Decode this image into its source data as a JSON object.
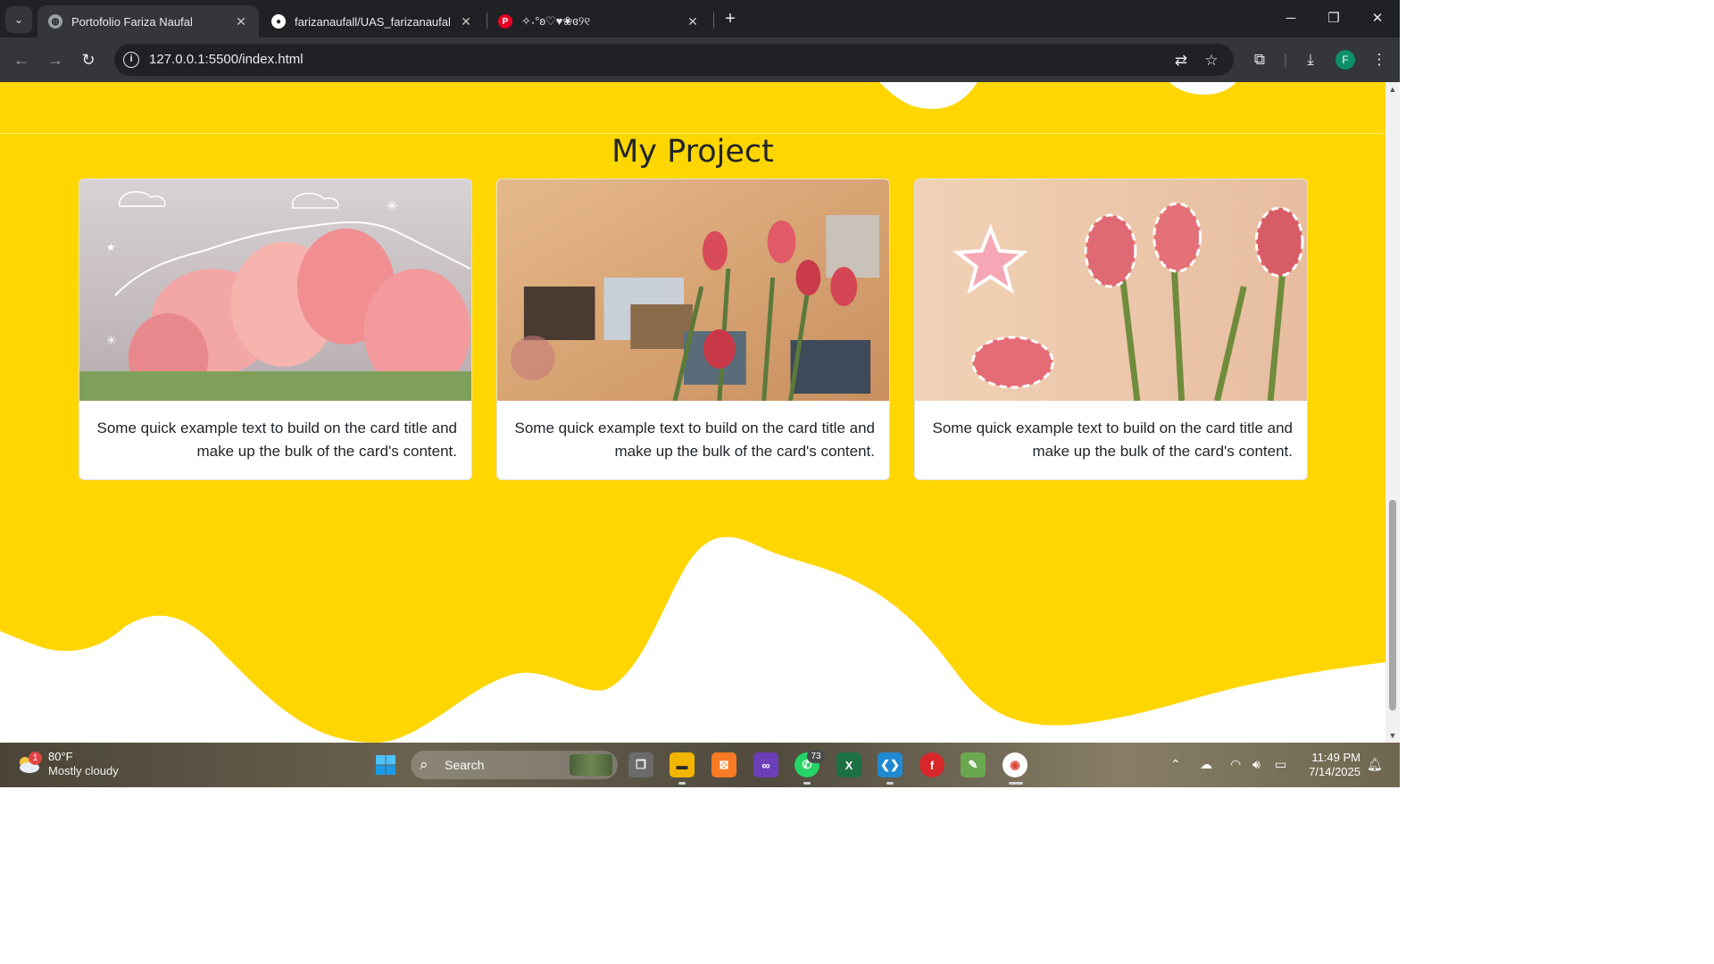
{
  "browser": {
    "tabs": [
      {
        "title": "Portofolio Fariza Naufal",
        "active": true
      },
      {
        "title": "farizanaufall/UAS_farizanaufal",
        "active": false
      },
      {
        "title": "✧˖°ʚ♡♥❀ɞ୨୧",
        "active": false
      }
    ],
    "url": "127.0.0.1:5500/index.html",
    "profile_initial": "F"
  },
  "page": {
    "section_title": "My Project",
    "cards": [
      {
        "text": "Some quick example text to build on the card title and make up the bulk of the card's content."
      },
      {
        "text": "Some quick example text to build on the card title and make up the bulk of the card's content."
      },
      {
        "text": "Some quick example text to build on the card title and make up the bulk of the card's content."
      }
    ],
    "colors": {
      "background": "#ffd600",
      "card": "#ffffff",
      "wave": "#ffffff"
    }
  },
  "taskbar": {
    "weather": {
      "temp": "80°F",
      "condition": "Mostly cloudy",
      "badge": "1"
    },
    "search_label": "Search",
    "whatsapp_badge": "73",
    "time": "11:49 PM",
    "date": "7/14/2025"
  }
}
